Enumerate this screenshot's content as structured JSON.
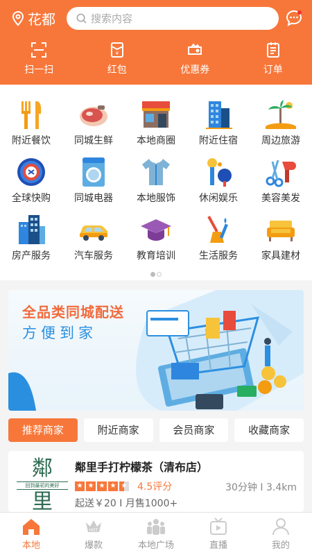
{
  "header": {
    "city": "花都",
    "search_placeholder": "搜索内容",
    "quick_actions": [
      {
        "label": "扫一扫",
        "icon": "scan-icon"
      },
      {
        "label": "红包",
        "icon": "red-packet-icon"
      },
      {
        "label": "优惠券",
        "icon": "coupon-icon"
      },
      {
        "label": "订单",
        "icon": "order-icon"
      }
    ]
  },
  "categories": [
    {
      "label": "附近餐饮",
      "icon": "fork-knife-icon"
    },
    {
      "label": "同城生鲜",
      "icon": "meat-icon"
    },
    {
      "label": "本地商圈",
      "icon": "storefront-icon"
    },
    {
      "label": "附近住宿",
      "icon": "hotel-building-icon"
    },
    {
      "label": "周边旅游",
      "icon": "palm-island-icon"
    },
    {
      "label": "全球快购",
      "icon": "globe-badge-icon"
    },
    {
      "label": "同城电器",
      "icon": "washing-machine-icon"
    },
    {
      "label": "本地服饰",
      "icon": "shirt-icon"
    },
    {
      "label": "休闲娱乐",
      "icon": "mic-pingpong-icon"
    },
    {
      "label": "美容美发",
      "icon": "scissors-hairdryer-icon"
    },
    {
      "label": "房产服务",
      "icon": "apartment-icon"
    },
    {
      "label": "汽车服务",
      "icon": "car-icon"
    },
    {
      "label": "教育培训",
      "icon": "graduation-cap-icon"
    },
    {
      "label": "生活服务",
      "icon": "broom-wrench-icon"
    },
    {
      "label": "家具建材",
      "icon": "sofa-icon"
    }
  ],
  "pagination": {
    "current": 1,
    "total": 2
  },
  "banner": {
    "title": "全品类同城配送",
    "subtitle": "方便到家"
  },
  "tabs": [
    {
      "label": "推荐商家",
      "active": true
    },
    {
      "label": "附近商家",
      "active": false
    },
    {
      "label": "会员商家",
      "active": false
    },
    {
      "label": "收藏商家",
      "active": false
    }
  ],
  "store": {
    "logo_big_top": "鄰",
    "logo_tagline": "回到最初的美好",
    "logo_big_bottom": "里",
    "name": "鄰里手打柠檬茶（清布店）",
    "stars": 4.5,
    "score_text": "4.5评分",
    "distance_text": "30分钟 I 3.4km",
    "sub_text": "起送￥20 I 月售1000+"
  },
  "bottom_nav": [
    {
      "label": "本地",
      "icon": "home-icon",
      "active": true
    },
    {
      "label": "爆款",
      "icon": "crown-hot-icon",
      "active": false
    },
    {
      "label": "本地广场",
      "icon": "people-group-icon",
      "active": false
    },
    {
      "label": "直播",
      "icon": "live-video-icon",
      "active": false
    },
    {
      "label": "我的",
      "icon": "user-icon",
      "active": false
    }
  ],
  "colors": {
    "accent": "#f7773a",
    "banner_blue": "#2b8fe0"
  }
}
